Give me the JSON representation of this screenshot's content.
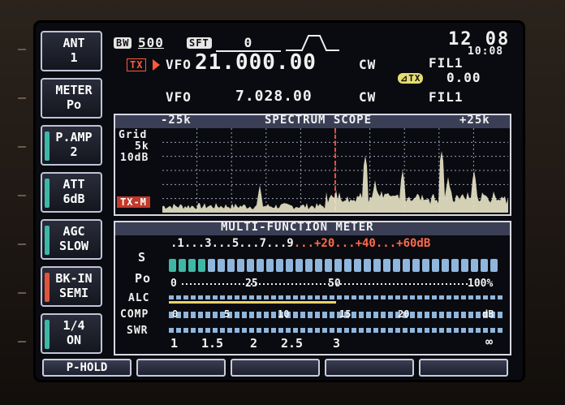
{
  "header": {
    "bw_tag": "BW",
    "bw_value": "500",
    "sft_tag": "SFT",
    "sft_value": "0",
    "clock": "12 08",
    "clock_small": "10:08"
  },
  "vfo_main": {
    "tx_badge": "TX",
    "label": "VFO",
    "frequency": "21.000.00",
    "mode": "CW",
    "filter": "FIL1"
  },
  "xit": {
    "badge": "⊿TX",
    "value": "0.00"
  },
  "vfo_sub": {
    "label": "VFO",
    "frequency": "7.028.00",
    "mode": "CW",
    "filter": "FIL1"
  },
  "side_buttons": [
    {
      "line1": "ANT",
      "line2": "1",
      "indicator": ""
    },
    {
      "line1": "METER",
      "line2": "Po",
      "indicator": ""
    },
    {
      "line1": "P.AMP",
      "line2": "2",
      "indicator": "#3fb7a6"
    },
    {
      "line1": "ATT",
      "line2": "6dB",
      "indicator": "#3fb7a6"
    },
    {
      "line1": "AGC",
      "line2": "SLOW",
      "indicator": "#3fb7a6"
    },
    {
      "line1": "BK-IN",
      "line2": "SEMI",
      "indicator": "#e0553a"
    },
    {
      "line1": "1/4",
      "line2": "ON",
      "indicator": "#3fb7a6"
    }
  ],
  "scope": {
    "title": "SPECTRUM SCOPE",
    "left_span": "-25k",
    "right_span": "+25k",
    "grid_label": "Grid",
    "grid_span": "5k",
    "grid_db": "10dB",
    "tx_marker": "TX-M"
  },
  "meter": {
    "title": "MULTI-FUNCTION METER",
    "s_label": "S",
    "s_scale_white": ".1...3...5...7...9",
    "s_scale_red": "...+20...+40...+60dB",
    "po_label": "Po",
    "po_scale": [
      "0",
      "25",
      "50",
      "100%"
    ],
    "alc_label": "ALC",
    "comp_label": "COMP",
    "comp_scale": [
      "0",
      "5",
      "10",
      "15",
      "20",
      "dB"
    ],
    "swr_label": "SWR",
    "swr_scale": [
      "1",
      "1.5",
      "2",
      "2.5",
      "3",
      "∞"
    ]
  },
  "bottom_buttons": [
    "P-HOLD",
    "",
    "",
    "",
    ""
  ],
  "colors": {
    "accent_teal": "#3fb7a6",
    "tx_red": "#e0553a",
    "meter_blue": "#8fb6dd",
    "alc_yellow": "#e8d36a"
  }
}
